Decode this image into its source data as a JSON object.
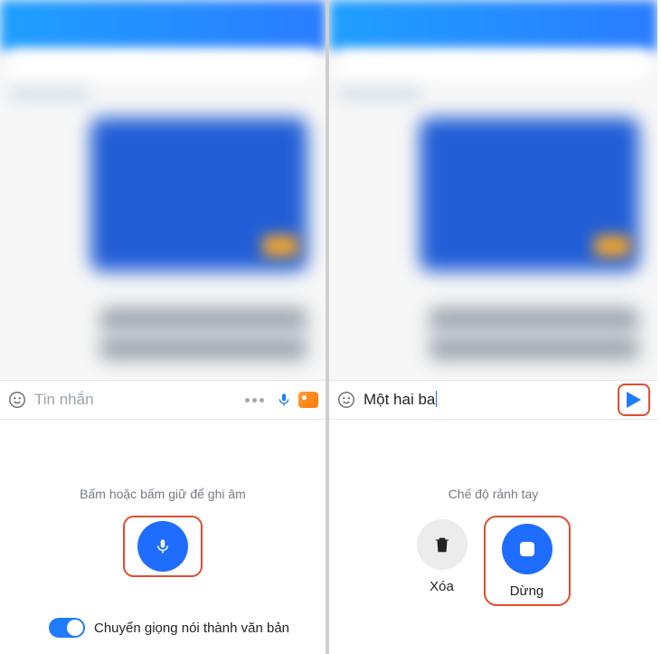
{
  "left": {
    "input": {
      "placeholder": "Tin nhắn"
    },
    "hint": "Bấm hoặc bấm giữ để ghi âm",
    "toggle_label": "Chuyển giọng nói thành văn bản",
    "toggle_on": true
  },
  "right": {
    "input": {
      "value": "Một hai ba"
    },
    "hint": "Chế độ rảnh tay",
    "delete_label": "Xóa",
    "stop_label": "Dừng"
  },
  "icons": {
    "emoji": "emoji-icon",
    "more": "more-icon",
    "mic": "mic-icon",
    "image": "image-icon",
    "send": "send-icon",
    "trash": "trash-icon",
    "stop": "stop-icon"
  },
  "colors": {
    "accent": "#1f7cff",
    "highlight": "#e34b2e"
  }
}
